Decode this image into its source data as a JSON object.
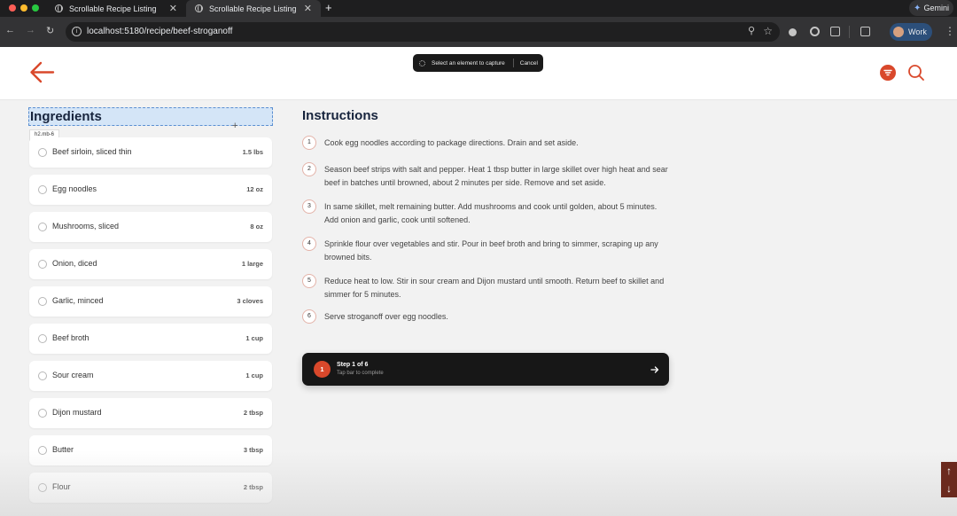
{
  "browser": {
    "tabs": [
      {
        "title": "Scrollable Recipe Listing",
        "active": false
      },
      {
        "title": "Scrollable Recipe Listing",
        "active": true
      }
    ],
    "url": "localhost:5180/recipe/beef-stroganoff",
    "gemini_label": "Gemini",
    "profile_label": "Work"
  },
  "capture_bar": {
    "prompt": "Select an element to capture",
    "cancel_label": "Cancel"
  },
  "inspector": {
    "tooltip": "h2.mb-6"
  },
  "colors": {
    "accent": "#d9482b",
    "dark_bar": "#171717",
    "heading": "#17243d"
  },
  "ingredients": {
    "title": "Ingredients",
    "items": [
      {
        "name": "Beef sirloin, sliced thin",
        "qty": "1.5 lbs"
      },
      {
        "name": "Egg noodles",
        "qty": "12 oz"
      },
      {
        "name": "Mushrooms, sliced",
        "qty": "8 oz"
      },
      {
        "name": "Onion, diced",
        "qty": "1 large"
      },
      {
        "name": "Garlic, minced",
        "qty": "3 cloves"
      },
      {
        "name": "Beef broth",
        "qty": "1 cup"
      },
      {
        "name": "Sour cream",
        "qty": "1 cup"
      },
      {
        "name": "Dijon mustard",
        "qty": "2 tbsp"
      },
      {
        "name": "Butter",
        "qty": "3 tbsp"
      },
      {
        "name": "Flour",
        "qty": "2 tbsp"
      }
    ]
  },
  "instructions": {
    "title": "Instructions",
    "steps": [
      {
        "num": "1",
        "text": "Cook egg noodles according to package directions. Drain and set aside."
      },
      {
        "num": "2",
        "text": "Season beef strips with salt and pepper. Heat 1 tbsp butter in large skillet over high heat and sear beef in batches until browned, about 2 minutes per side. Remove and set aside."
      },
      {
        "num": "3",
        "text": "In same skillet, melt remaining butter. Add mushrooms and cook until golden, about 5 minutes. Add onion and garlic, cook until softened."
      },
      {
        "num": "4",
        "text": "Sprinkle flour over vegetables and stir. Pour in beef broth and bring to simmer, scraping up any browned bits."
      },
      {
        "num": "5",
        "text": "Reduce heat to low. Stir in sour cream and Dijon mustard until smooth. Return beef to skillet and simmer for 5 minutes."
      },
      {
        "num": "6",
        "text": "Serve stroganoff over egg noodles."
      }
    ]
  },
  "step_bar": {
    "num": "1",
    "title": "Step 1 of 6",
    "subtitle": "Tap bar to complete"
  }
}
